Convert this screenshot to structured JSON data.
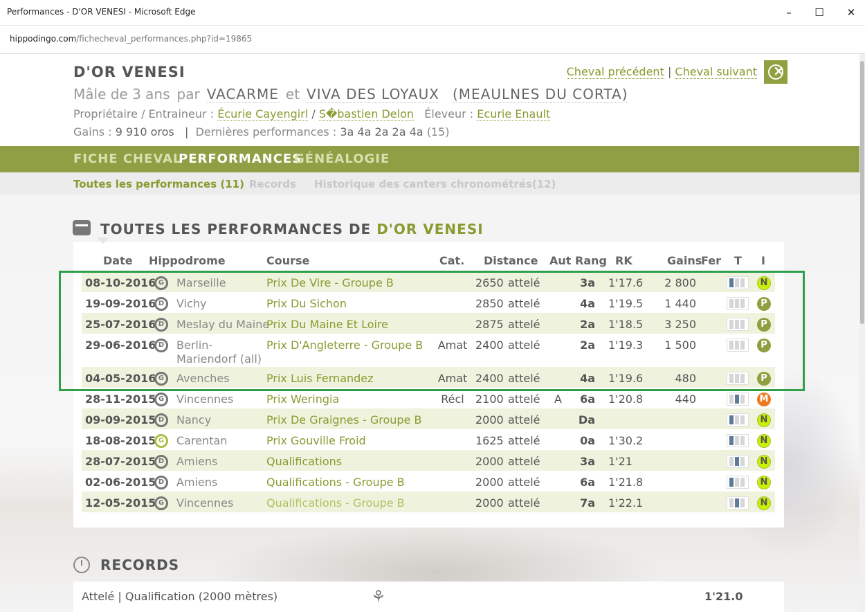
{
  "window": {
    "title": "Performances - D'OR VENESI - Microsoft Edge",
    "url_domain": "hippodingo.com",
    "url_path": "/fichecheval_performances.php?id=19865"
  },
  "horse": {
    "name": "D'OR VENESI",
    "sex_age": "Mâle de 3 ans",
    "par": "par",
    "sire": "VACARME",
    "et": "et",
    "dam": "VIVA DES LOYAUX",
    "damsire": "(MEAULNES DU CORTA)",
    "owner_trainer_label": "Propriétaire / Entraineur :",
    "owner": "Écurie Cayengirl",
    "slash": "/",
    "trainer": "S�bastien Delon",
    "breeder_label": "Éleveur :",
    "breeder": "Ecurie Enault",
    "gains_label": "Gains :",
    "gains": "9 910 oros",
    "sep": "|",
    "last_perf_label": "Dernières performances :",
    "last_perf": "3a 4a 2a 2a 4a",
    "last_perf_count": "(15)"
  },
  "nav": {
    "prev": "Cheval précédent",
    "sep": "|",
    "next": "Cheval suivant",
    "tabs": [
      "FICHE CHEVAL",
      "PERFORMANCES",
      "GÉNÉALOGIE"
    ],
    "subtabs": [
      "Toutes les performances (11)",
      "Records",
      "Historique des canters chronométrés(12)"
    ]
  },
  "colors": {
    "accent": "#909f43",
    "link": "#8a9a30",
    "row_alt": "#eff3dd",
    "highlight_box": "#2ea04a"
  },
  "performances": {
    "title_prefix": "TOUTES LES PERFORMANCES DE",
    "title_horse": "D'OR VENESI",
    "columns": [
      "Date",
      "Hippodrome",
      "Course",
      "Cat.",
      "Distance",
      "Aut",
      "Rang",
      "RK",
      "Gains",
      "Fer",
      "T",
      "I"
    ],
    "rows": [
      {
        "date": "08-10-2016",
        "hippodrome": "Marseille",
        "course": "Prix De Vire - Groupe B",
        "cat": "",
        "distance": "2650",
        "type": "attelé",
        "aut": "",
        "rang": "3a",
        "rk": "1'17.6",
        "gains": "2 800",
        "track_icon": "G",
        "badge": "N"
      },
      {
        "date": "19-09-2016",
        "hippodrome": "Vichy",
        "course": "Prix Du Sichon",
        "cat": "",
        "distance": "2850",
        "type": "attelé",
        "aut": "",
        "rang": "4a",
        "rk": "1'19.5",
        "gains": "1 440",
        "track_icon": "D",
        "badge": "P"
      },
      {
        "date": "25-07-2016",
        "hippodrome": "Meslay du Maine",
        "course": "Prix Du Maine Et Loire",
        "cat": "",
        "distance": "2875",
        "type": "attelé",
        "aut": "",
        "rang": "2a",
        "rk": "1'18.5",
        "gains": "3 250",
        "track_icon": "D",
        "badge": "P"
      },
      {
        "date": "29-06-2016",
        "hippodrome": "Berlin-",
        "hippodrome2": "Mariendorf (all)",
        "course": "Prix D'Angleterre - Groupe B",
        "cat": "Amat",
        "distance": "2400",
        "type": "attelé",
        "aut": "",
        "rang": "2a",
        "rk": "1'19.3",
        "gains": "1 500",
        "track_icon": "D",
        "badge": "P"
      },
      {
        "date": "04-05-2016",
        "hippodrome": "Avenches",
        "course": "Prix Luis Fernandez",
        "cat": "Amat",
        "distance": "2400",
        "type": "attelé",
        "aut": "",
        "rang": "4a",
        "rk": "1'19.6",
        "gains": "480",
        "track_icon": "G",
        "badge": "P"
      },
      {
        "date": "28-11-2015",
        "hippodrome": "Vincennes",
        "course": "Prix Weringia",
        "cat": "Récl",
        "distance": "2100",
        "type": "attelé",
        "aut": "A",
        "rang": "6a",
        "rk": "1'20.8",
        "gains": "440",
        "track_icon": "G",
        "badge": "M"
      },
      {
        "date": "09-09-2015",
        "hippodrome": "Nancy",
        "course": "Prix De Graignes - Groupe B",
        "cat": "",
        "distance": "2000",
        "type": "attelé",
        "aut": "",
        "rang": "Da",
        "rk": "",
        "gains": "",
        "track_icon": "D",
        "badge": "N"
      },
      {
        "date": "18-08-2015",
        "hippodrome": "Carentan",
        "course": "Prix Gouville Froid",
        "cat": "",
        "distance": "1625",
        "type": "attelé",
        "aut": "",
        "rang": "0a",
        "rk": "1'30.2",
        "gains": "",
        "track_icon": "G",
        "badge": "N"
      },
      {
        "date": "28-07-2015",
        "hippodrome": "Amiens",
        "course": "Qualifications",
        "cat": "",
        "distance": "2000",
        "type": "attelé",
        "aut": "",
        "rang": "3a",
        "rk": "1'21",
        "gains": "",
        "track_icon": "D",
        "badge": "N"
      },
      {
        "date": "02-06-2015",
        "hippodrome": "Amiens",
        "course": "Qualifications - Groupe B",
        "cat": "",
        "distance": "2000",
        "type": "attelé",
        "aut": "",
        "rang": "6a",
        "rk": "1'21.8",
        "gains": "",
        "track_icon": "D",
        "badge": "N"
      },
      {
        "date": "12-05-2015",
        "hippodrome": "Vincennes",
        "course": "Qualifications - Groupe B",
        "cat": "",
        "distance": "2000",
        "type": "attelé",
        "aut": "",
        "rang": "7a",
        "rk": "1'22.1",
        "gains": "",
        "track_icon": "G",
        "badge": "N"
      }
    ]
  },
  "records": {
    "title": "RECORDS",
    "label": "Attelé | Qualification (2000 mètres)",
    "time": "1'21.0"
  }
}
